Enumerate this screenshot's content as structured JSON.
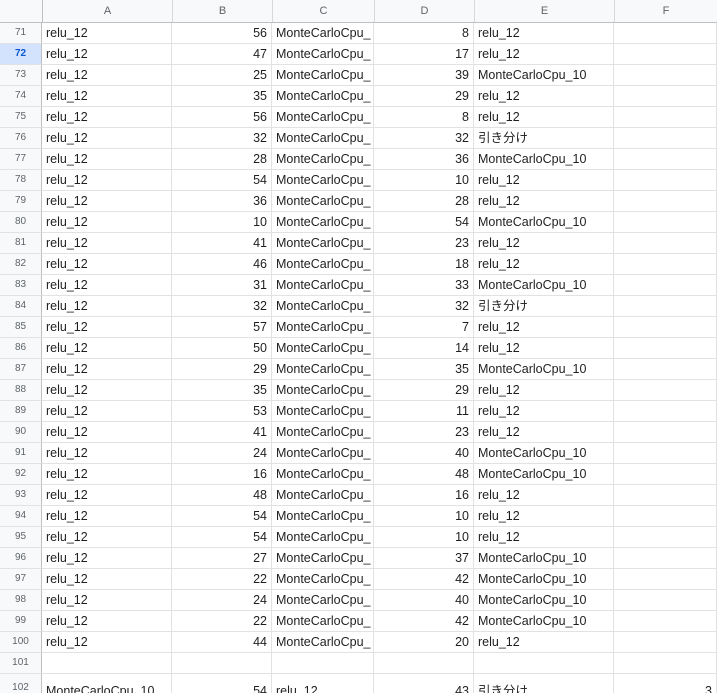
{
  "columns": [
    "A",
    "B",
    "C",
    "D",
    "E",
    "F"
  ],
  "selected_row": "72",
  "rows": [
    {
      "n": "71",
      "a": "relu_12",
      "b": "56",
      "c": "MonteCarloCpu_",
      "d": "8",
      "e": "relu_12",
      "f": ""
    },
    {
      "n": "72",
      "a": "relu_12",
      "b": "47",
      "c": "MonteCarloCpu_",
      "d": "17",
      "e": "relu_12",
      "f": ""
    },
    {
      "n": "73",
      "a": "relu_12",
      "b": "25",
      "c": "MonteCarloCpu_",
      "d": "39",
      "e": "MonteCarloCpu_10",
      "f": ""
    },
    {
      "n": "74",
      "a": "relu_12",
      "b": "35",
      "c": "MonteCarloCpu_",
      "d": "29",
      "e": "relu_12",
      "f": ""
    },
    {
      "n": "75",
      "a": "relu_12",
      "b": "56",
      "c": "MonteCarloCpu_",
      "d": "8",
      "e": "relu_12",
      "f": ""
    },
    {
      "n": "76",
      "a": "relu_12",
      "b": "32",
      "c": "MonteCarloCpu_",
      "d": "32",
      "e": "引き分け",
      "f": ""
    },
    {
      "n": "77",
      "a": "relu_12",
      "b": "28",
      "c": "MonteCarloCpu_",
      "d": "36",
      "e": "MonteCarloCpu_10",
      "f": ""
    },
    {
      "n": "78",
      "a": "relu_12",
      "b": "54",
      "c": "MonteCarloCpu_",
      "d": "10",
      "e": "relu_12",
      "f": ""
    },
    {
      "n": "79",
      "a": "relu_12",
      "b": "36",
      "c": "MonteCarloCpu_",
      "d": "28",
      "e": "relu_12",
      "f": ""
    },
    {
      "n": "80",
      "a": "relu_12",
      "b": "10",
      "c": "MonteCarloCpu_",
      "d": "54",
      "e": "MonteCarloCpu_10",
      "f": ""
    },
    {
      "n": "81",
      "a": "relu_12",
      "b": "41",
      "c": "MonteCarloCpu_",
      "d": "23",
      "e": "relu_12",
      "f": ""
    },
    {
      "n": "82",
      "a": "relu_12",
      "b": "46",
      "c": "MonteCarloCpu_",
      "d": "18",
      "e": "relu_12",
      "f": ""
    },
    {
      "n": "83",
      "a": "relu_12",
      "b": "31",
      "c": "MonteCarloCpu_",
      "d": "33",
      "e": "MonteCarloCpu_10",
      "f": ""
    },
    {
      "n": "84",
      "a": "relu_12",
      "b": "32",
      "c": "MonteCarloCpu_",
      "d": "32",
      "e": "引き分け",
      "f": ""
    },
    {
      "n": "85",
      "a": "relu_12",
      "b": "57",
      "c": "MonteCarloCpu_",
      "d": "7",
      "e": "relu_12",
      "f": ""
    },
    {
      "n": "86",
      "a": "relu_12",
      "b": "50",
      "c": "MonteCarloCpu_",
      "d": "14",
      "e": "relu_12",
      "f": ""
    },
    {
      "n": "87",
      "a": "relu_12",
      "b": "29",
      "c": "MonteCarloCpu_",
      "d": "35",
      "e": "MonteCarloCpu_10",
      "f": ""
    },
    {
      "n": "88",
      "a": "relu_12",
      "b": "35",
      "c": "MonteCarloCpu_",
      "d": "29",
      "e": "relu_12",
      "f": ""
    },
    {
      "n": "89",
      "a": "relu_12",
      "b": "53",
      "c": "MonteCarloCpu_",
      "d": "11",
      "e": "relu_12",
      "f": ""
    },
    {
      "n": "90",
      "a": "relu_12",
      "b": "41",
      "c": "MonteCarloCpu_",
      "d": "23",
      "e": "relu_12",
      "f": ""
    },
    {
      "n": "91",
      "a": "relu_12",
      "b": "24",
      "c": "MonteCarloCpu_",
      "d": "40",
      "e": "MonteCarloCpu_10",
      "f": ""
    },
    {
      "n": "92",
      "a": "relu_12",
      "b": "16",
      "c": "MonteCarloCpu_",
      "d": "48",
      "e": "MonteCarloCpu_10",
      "f": ""
    },
    {
      "n": "93",
      "a": "relu_12",
      "b": "48",
      "c": "MonteCarloCpu_",
      "d": "16",
      "e": "relu_12",
      "f": ""
    },
    {
      "n": "94",
      "a": "relu_12",
      "b": "54",
      "c": "MonteCarloCpu_",
      "d": "10",
      "e": "relu_12",
      "f": ""
    },
    {
      "n": "95",
      "a": "relu_12",
      "b": "54",
      "c": "MonteCarloCpu_",
      "d": "10",
      "e": "relu_12",
      "f": ""
    },
    {
      "n": "96",
      "a": "relu_12",
      "b": "27",
      "c": "MonteCarloCpu_",
      "d": "37",
      "e": "MonteCarloCpu_10",
      "f": ""
    },
    {
      "n": "97",
      "a": "relu_12",
      "b": "22",
      "c": "MonteCarloCpu_",
      "d": "42",
      "e": "MonteCarloCpu_10",
      "f": ""
    },
    {
      "n": "98",
      "a": "relu_12",
      "b": "24",
      "c": "MonteCarloCpu_",
      "d": "40",
      "e": "MonteCarloCpu_10",
      "f": ""
    },
    {
      "n": "99",
      "a": "relu_12",
      "b": "22",
      "c": "MonteCarloCpu_",
      "d": "42",
      "e": "MonteCarloCpu_10",
      "f": ""
    },
    {
      "n": "100",
      "a": "relu_12",
      "b": "44",
      "c": "MonteCarloCpu_",
      "d": "20",
      "e": "relu_12",
      "f": ""
    },
    {
      "n": "101",
      "a": "",
      "b": "",
      "c": "",
      "d": "",
      "e": "",
      "f": ""
    },
    {
      "n": "102",
      "a": "MonteCarloCpu_10",
      "b": "54",
      "c": "relu_12",
      "d": "43",
      "e": "引き分け",
      "f": "3"
    }
  ]
}
